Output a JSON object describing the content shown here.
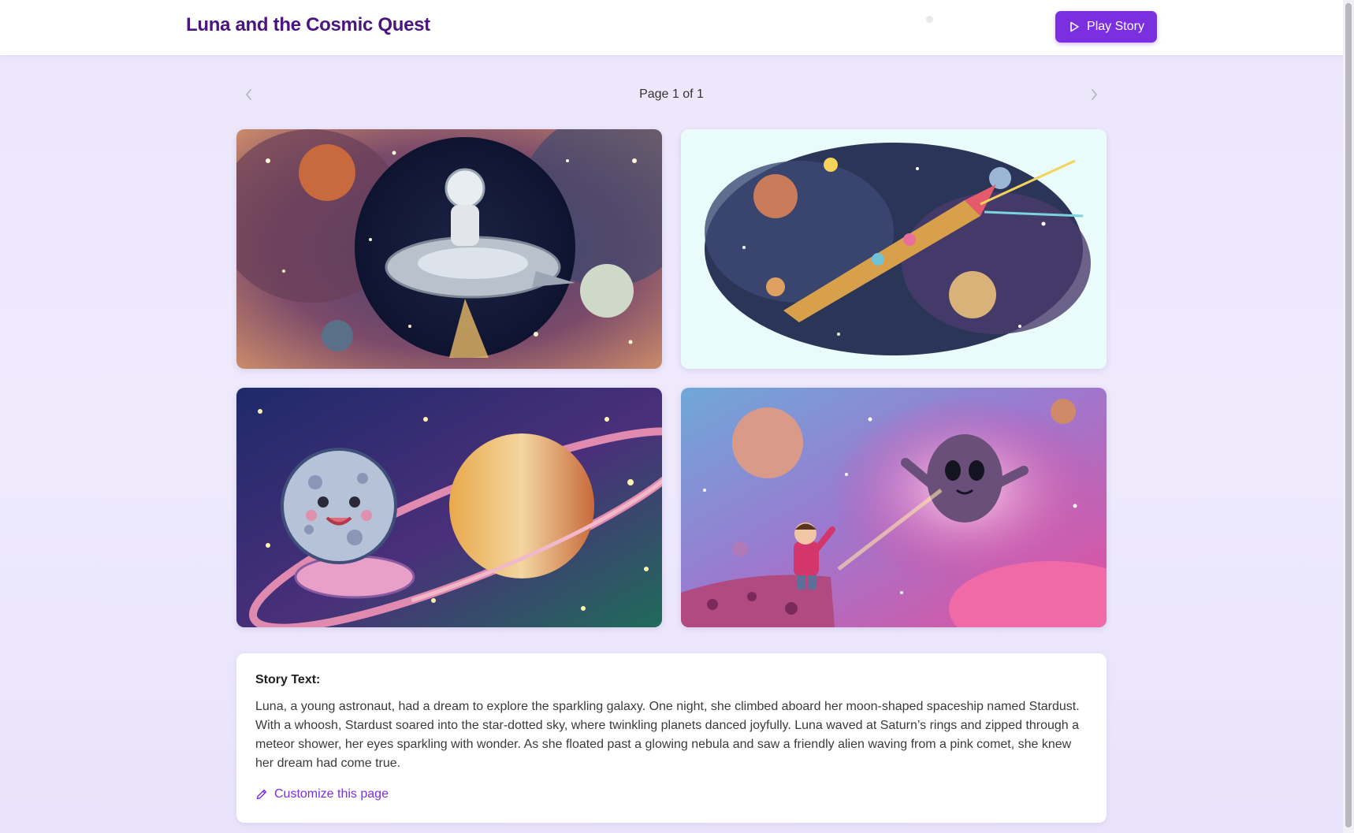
{
  "header": {
    "title": "Luna and the Cosmic Quest",
    "play_label": "Play Story",
    "play_icon": "play-icon"
  },
  "pager": {
    "label": "Page 1 of 1",
    "prev_icon": "chevron-left-icon",
    "next_icon": "chevron-right-icon"
  },
  "illustrations": [
    {
      "name": "astronaut-on-spaceship-image",
      "subject": "young astronaut riding a spaceship"
    },
    {
      "name": "colorful-rocket-image",
      "subject": "colorful rocket among planets"
    },
    {
      "name": "smiling-moon-and-saturn-image",
      "subject": "smiling moon in a saucer beside a ringed planet"
    },
    {
      "name": "child-and-friendly-alien-image",
      "subject": "child waving at a friendly alien in a pink nebula"
    }
  ],
  "story": {
    "heading": "Story Text:",
    "body": "Luna, a young astronaut, had a dream to explore the sparkling galaxy. One night, she climbed aboard her moon-shaped spaceship named Stardust. With a whoosh, Stardust soared into the star-dotted sky, where twinkling planets danced joyfully. Luna waved at Saturn’s rings and zipped through a meteor shower, her eyes sparkling with wonder. As she floated past a glowing nebula and saw a friendly alien waving from a pink comet, she knew her dream had come true.",
    "customize_label": "Customize this page",
    "customize_icon": "pencil-icon"
  },
  "colors": {
    "accent": "#7b2fe0",
    "title": "#4b1580",
    "background": "#ede6fb"
  }
}
